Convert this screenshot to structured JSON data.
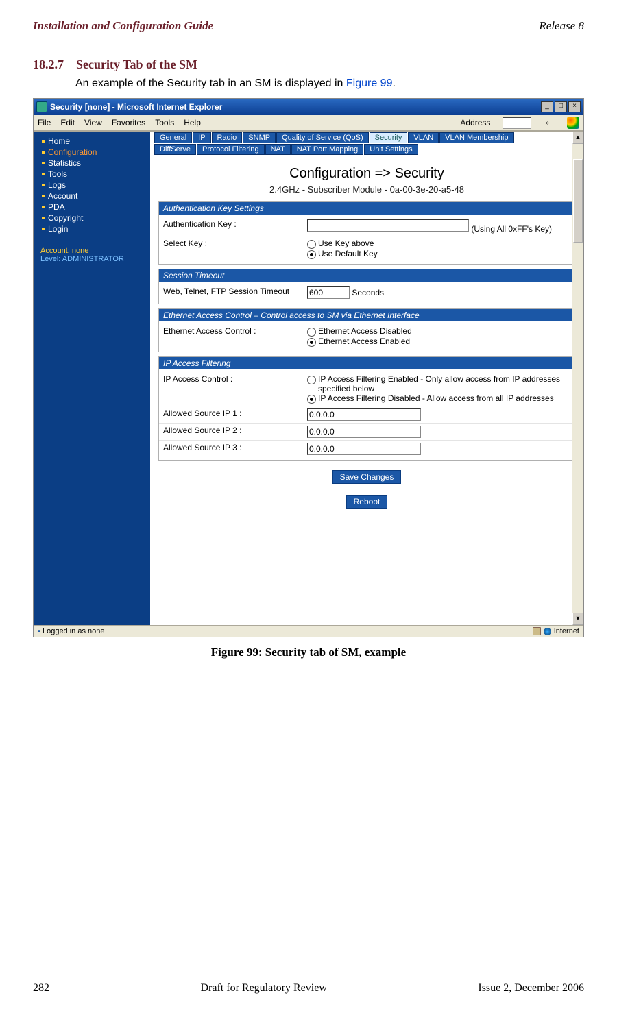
{
  "header": {
    "left": "Installation and Configuration Guide",
    "right": "Release 8"
  },
  "section": {
    "num": "18.2.7",
    "title": "Security Tab of the SM"
  },
  "intro": {
    "pre": "An example of the Security tab in an SM is displayed in ",
    "link": "Figure 99",
    "post": "."
  },
  "caption": "Figure 99: Security tab of SM, example",
  "footer": {
    "left": "282",
    "mid": "Draft for Regulatory Review",
    "right": "Issue 2, December 2006"
  },
  "window": {
    "title": "Security [none] - Microsoft Internet Explorer",
    "menus": [
      "File",
      "Edit",
      "View",
      "Favorites",
      "Tools",
      "Help"
    ],
    "address_label": "Address",
    "chev": "»"
  },
  "sidebar": {
    "items": [
      "Home",
      "Configuration",
      "Statistics",
      "Tools",
      "Logs",
      "Account",
      "PDA",
      "Copyright",
      "Login"
    ],
    "highlight_idx": 1,
    "acct1": "Account: none",
    "acct2": "Level: ADMINISTRATOR"
  },
  "tabs1": [
    "General",
    "IP",
    "Radio",
    "SNMP",
    "Quality of Service (QoS)",
    "Security",
    "VLAN",
    "VLAN Membership"
  ],
  "tabs2": [
    "DiffServe",
    "Protocol Filtering",
    "NAT",
    "NAT Port Mapping",
    "Unit Settings"
  ],
  "active_tab": "Security",
  "page_title": "Configuration => Security",
  "page_sub": "2.4GHz - Subscriber Module - 0a-00-3e-20-a5-48",
  "panels": {
    "authkey": {
      "hd": "Authentication Key Settings",
      "row1_lbl": "Authentication Key :",
      "row1_note": "(Using All 0xFF's Key)",
      "row2_lbl": "Select Key :",
      "opt1": "Use Key above",
      "opt2": "Use Default Key"
    },
    "session": {
      "hd": "Session Timeout",
      "lbl": "Web, Telnet, FTP Session Timeout",
      "val": "600",
      "unit": "Seconds"
    },
    "eth": {
      "hd": "Ethernet Access Control – Control access to SM via Ethernet Interface",
      "lbl": "Ethernet Access Control :",
      "opt1": "Ethernet Access Disabled",
      "opt2": "Ethernet Access Enabled"
    },
    "ipf": {
      "hd": "IP Access Filtering",
      "lbl": "IP Access Control :",
      "opt1": "IP Access Filtering Enabled - Only allow access from IP addresses specified below",
      "opt2": "IP Access Filtering Disabled - Allow access from all IP addresses",
      "iplbls": [
        "Allowed Source IP 1 :",
        "Allowed Source IP 2 :",
        "Allowed Source IP 3 :"
      ],
      "ipvals": [
        "0.0.0.0",
        "0.0.0.0",
        "0.0.0.0"
      ]
    },
    "save_btn": "Save Changes",
    "reboot_btn": "Reboot"
  },
  "status": {
    "left": "Logged in as none",
    "zone": "Internet"
  }
}
